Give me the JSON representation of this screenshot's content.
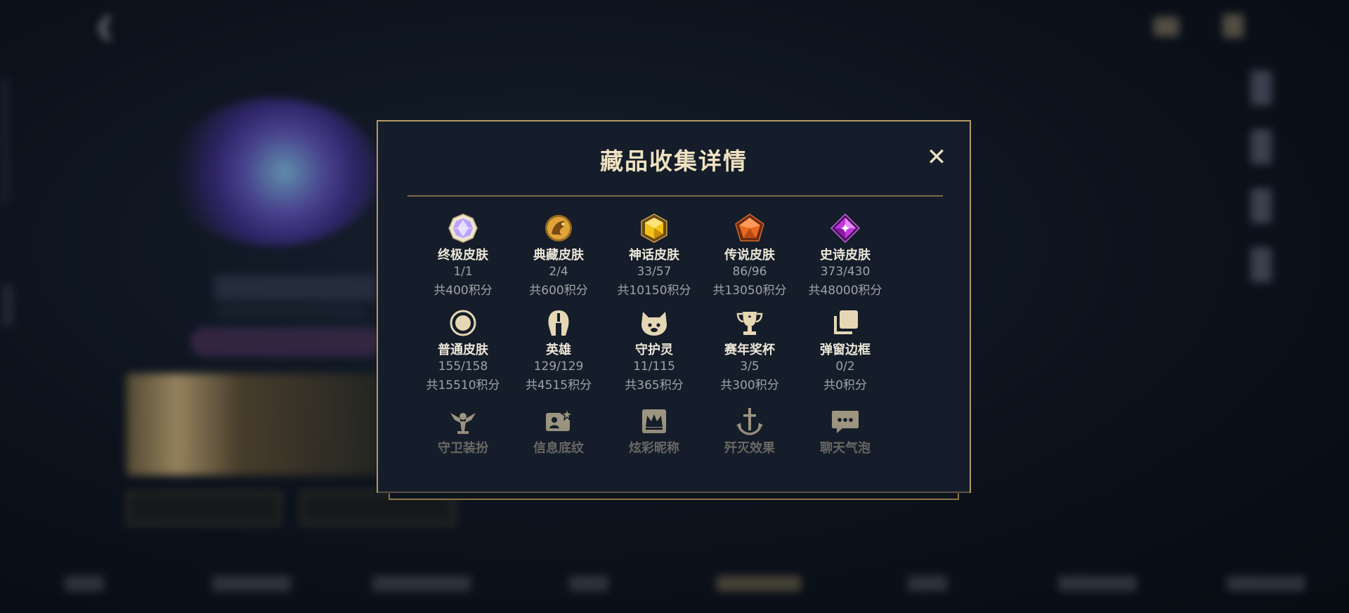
{
  "modal": {
    "title": "藏品收集详情",
    "close_label": "✕"
  },
  "items": [
    {
      "name": "终极皮肤",
      "count": "1/1",
      "points": "共400积分",
      "icon": "ultimate-gem-icon",
      "color": "#c8b0ff"
    },
    {
      "name": "典藏皮肤",
      "count": "2/4",
      "points": "共600积分",
      "icon": "legendary-dragon-icon",
      "color": "#e1a63a"
    },
    {
      "name": "神话皮肤",
      "count": "33/57",
      "points": "共10150积分",
      "icon": "mythic-gem-icon",
      "color": "#f3c21a"
    },
    {
      "name": "传说皮肤",
      "count": "86/96",
      "points": "共13050积分",
      "icon": "legend-gem-icon",
      "color": "#ea6a22"
    },
    {
      "name": "史诗皮肤",
      "count": "373/430",
      "points": "共48000积分",
      "icon": "epic-gem-icon",
      "color": "#c435e0"
    },
    {
      "name": "普通皮肤",
      "count": "155/158",
      "points": "共15510积分",
      "icon": "common-circle-icon",
      "color": "#e6d7b4"
    },
    {
      "name": "英雄",
      "count": "129/129",
      "points": "共4515积分",
      "icon": "helmet-icon",
      "color": "#e6d7b4"
    },
    {
      "name": "守护灵",
      "count": "11/115",
      "points": "共365积分",
      "icon": "guardian-spirit-icon",
      "color": "#e6d7b4"
    },
    {
      "name": "赛年奖杯",
      "count": "3/5",
      "points": "共300积分",
      "icon": "trophy-icon",
      "color": "#e6d7b4"
    },
    {
      "name": "弹窗边框",
      "count": "0/2",
      "points": "共0积分",
      "icon": "frame-layers-icon",
      "color": "#e6d7b4"
    },
    {
      "name": "守卫装扮",
      "icon": "ward-icon",
      "color": "#d8c9a6"
    },
    {
      "name": "信息底纹",
      "icon": "profile-card-icon",
      "color": "#d8c9a6"
    },
    {
      "name": "炫彩昵称",
      "icon": "crown-nickname-icon",
      "color": "#d8c9a6"
    },
    {
      "name": "歼灭效果",
      "icon": "anchor-icon",
      "color": "#d8c9a6"
    },
    {
      "name": "聊天气泡",
      "icon": "chat-bubble-icon",
      "color": "#d8c9a6"
    }
  ]
}
